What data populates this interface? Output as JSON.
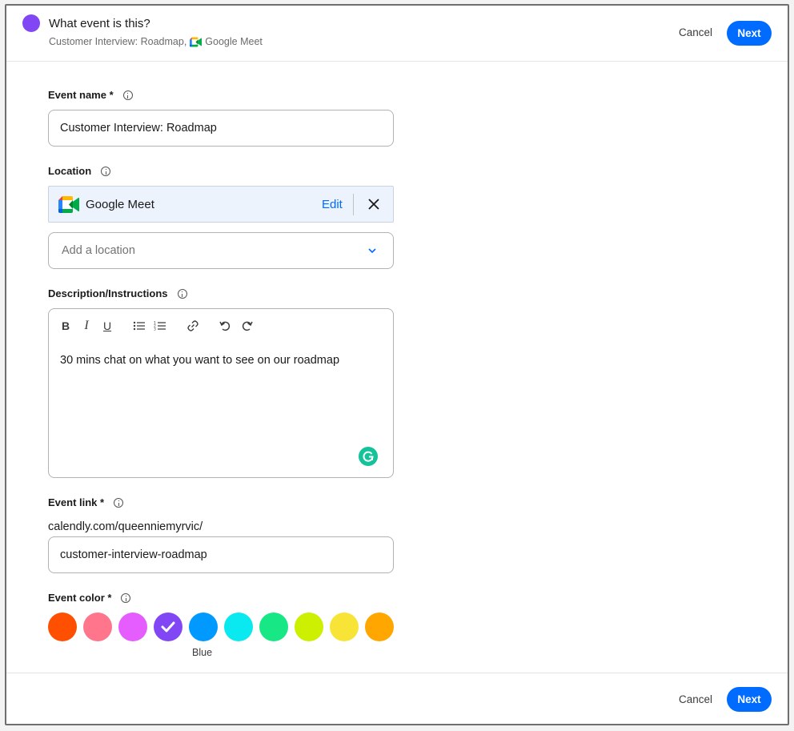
{
  "header": {
    "title": "What event is this?",
    "subtitle_event": "Customer Interview: Roadmap,",
    "subtitle_location": "Google Meet",
    "cancel_label": "Cancel",
    "next_label": "Next",
    "accent_color": "#8247f5"
  },
  "form": {
    "event_name": {
      "label": "Event name *",
      "value": "Customer Interview: Roadmap"
    },
    "location": {
      "label": "Location",
      "selected": "Google Meet",
      "edit_label": "Edit",
      "add_placeholder": "Add a location"
    },
    "description": {
      "label": "Description/Instructions",
      "value": "30 mins chat on what you want to see on our roadmap",
      "toolbar": [
        "bold-icon",
        "italic-icon",
        "underline-icon",
        "bullet-list-icon",
        "numbered-list-icon",
        "link-icon",
        "undo-icon",
        "redo-icon"
      ]
    },
    "event_link": {
      "label": "Event link *",
      "prefix": "calendly.com/queenniemyrvic/",
      "value": "customer-interview-roadmap"
    },
    "event_color": {
      "label": "Event color *",
      "selected_index": 3,
      "hover_label": "Blue",
      "swatches": [
        "#ff4f00",
        "#ff758c",
        "#e55cff",
        "#8247f5",
        "#0099ff",
        "#0ae8f0",
        "#17e885",
        "#ccf000",
        "#f8e436",
        "#ffa600"
      ]
    }
  },
  "footer": {
    "cancel_label": "Cancel",
    "next_label": "Next"
  },
  "colors": {
    "primary": "#006bff",
    "grammarly": "#15c39a"
  }
}
